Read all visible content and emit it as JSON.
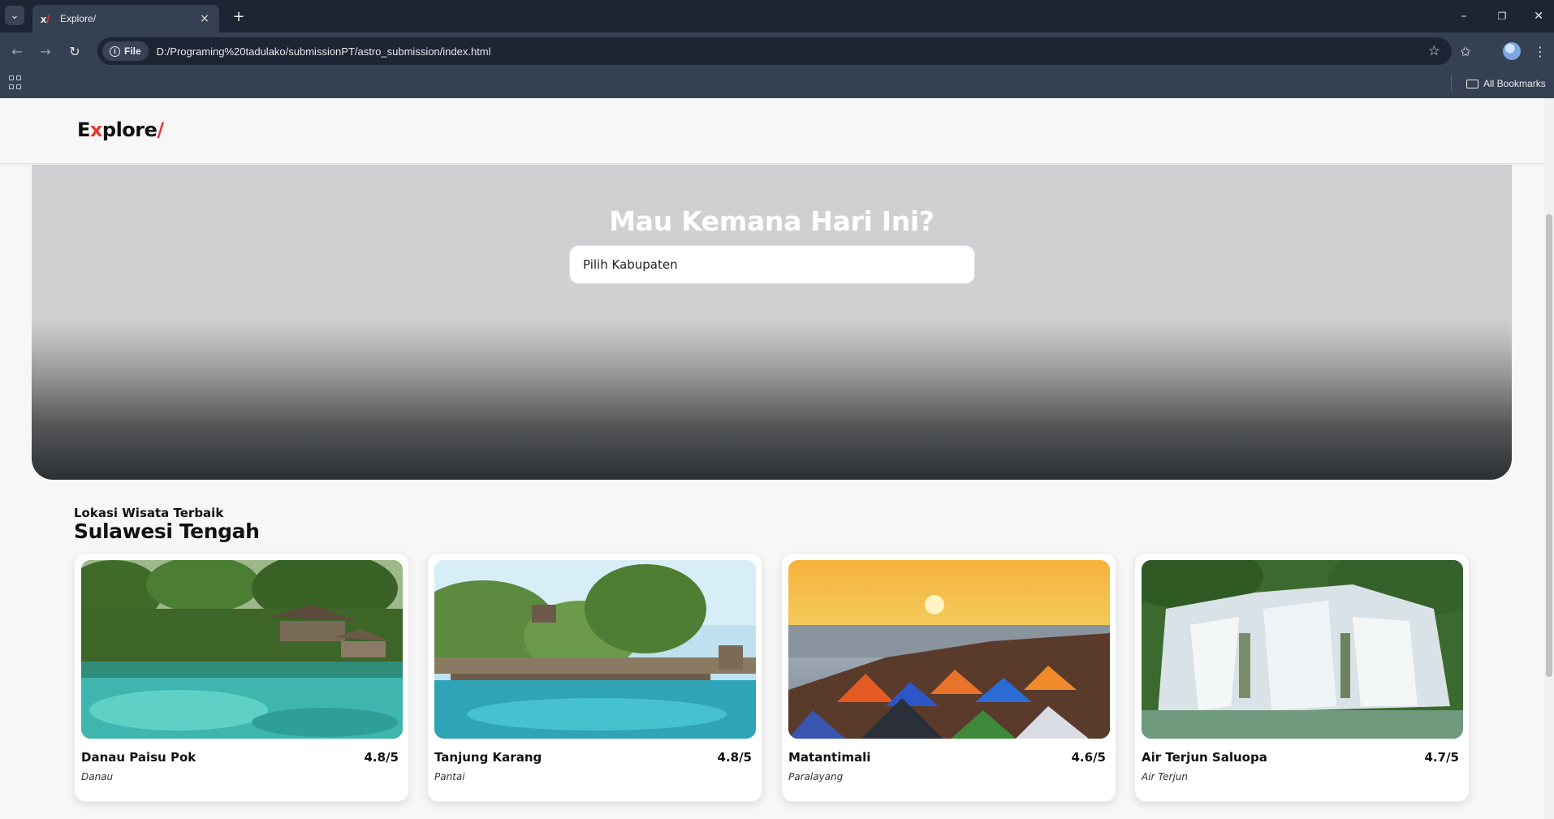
{
  "browser": {
    "tab_title": "Explore/",
    "tab_close": "×",
    "new_tab": "+",
    "site_chip": "File",
    "url": "D:/Programing%20tadulako/submissionPT/astro_submission/index.html",
    "all_bookmarks": "All Bookmarks",
    "controls": {
      "minimize": "–",
      "restore": "❐",
      "close": "✕",
      "back": "←",
      "forward": "→",
      "reload": "↻",
      "star": "☆",
      "tab_list": "⌄"
    }
  },
  "header": {
    "logo_e": "E",
    "logo_x": "x",
    "logo_rest": "plore",
    "logo_slash": "/"
  },
  "hero": {
    "title": "Mau Kemana Hari Ini?",
    "search_placeholder": "Pilih Kabupaten"
  },
  "section": {
    "subtitle": "Lokasi Wisata Terbaik",
    "title": "Sulawesi Tengah"
  },
  "destinations": [
    {
      "name": "Danau Paisu Pok",
      "rating": "4.8/5",
      "category": "Danau",
      "image": "lake-photo"
    },
    {
      "name": "Tanjung Karang",
      "rating": "4.8/5",
      "category": "Pantai",
      "image": "beach-photo"
    },
    {
      "name": "Matantimali",
      "rating": "4.6/5",
      "category": "Paralayang",
      "image": "sunset-camp-photo"
    },
    {
      "name": "Air Terjun Saluopa",
      "rating": "4.7/5",
      "category": "Air Terjun",
      "image": "waterfall-photo"
    }
  ],
  "colors": {
    "accent": "#e53935",
    "chrome_dark": "#1d2433",
    "chrome": "#354052",
    "page_bg": "#f7f7f7"
  }
}
